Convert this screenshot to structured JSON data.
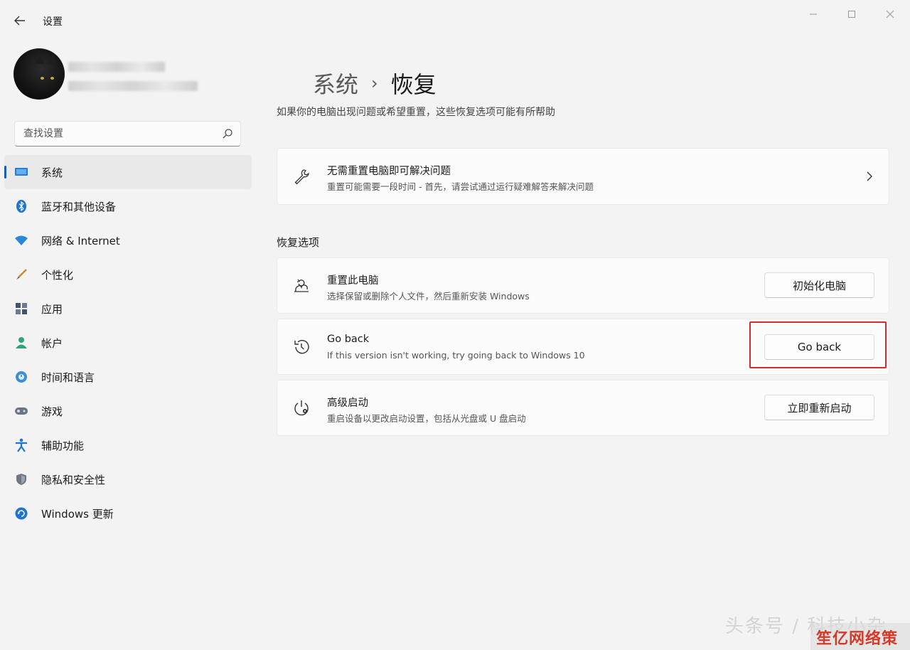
{
  "window": {
    "app_title": "设置",
    "back_icon": "back-arrow-icon",
    "controls": [
      "minimize-icon",
      "maximize-icon",
      "close-icon"
    ]
  },
  "search": {
    "placeholder": "查找设置",
    "icon": "search-icon"
  },
  "sidebar": {
    "items": [
      {
        "label": "系统",
        "icon": "monitor-icon",
        "active": true
      },
      {
        "label": "蓝牙和其他设备",
        "icon": "bluetooth-icon"
      },
      {
        "label": "网络 & Internet",
        "icon": "wifi-icon"
      },
      {
        "label": "个性化",
        "icon": "brush-icon"
      },
      {
        "label": "应用",
        "icon": "apps-icon"
      },
      {
        "label": "帐户",
        "icon": "account-icon"
      },
      {
        "label": "时间和语言",
        "icon": "globe-clock-icon"
      },
      {
        "label": "游戏",
        "icon": "gamepad-icon"
      },
      {
        "label": "辅助功能",
        "icon": "accessibility-icon"
      },
      {
        "label": "隐私和安全性",
        "icon": "shield-icon"
      },
      {
        "label": "Windows 更新",
        "icon": "update-icon"
      }
    ]
  },
  "main": {
    "breadcrumb_parent": "系统",
    "breadcrumb_sep": "›",
    "breadcrumb_current": "恢复",
    "subtitle": "如果你的电脑出现问题或希望重置，这些恢复选项可能有所帮助",
    "troubleshoot": {
      "title": "无需重置电脑即可解决问题",
      "desc": "重置可能需要一段时间 - 首先，请尝试通过运行疑难解答来解决问题",
      "icon": "wrench-icon"
    },
    "section_label": "恢复选项",
    "options": [
      {
        "title": "重置此电脑",
        "desc": "选择保留或删除个人文件，然后重新安装 Windows",
        "button": "初始化电脑",
        "icon": "reset-pc-icon"
      },
      {
        "title": "Go back",
        "desc": "If this version isn't working, try going back to Windows 10",
        "button": "Go back",
        "icon": "history-icon"
      },
      {
        "title": "高级启动",
        "desc": "重启设备以更改启动设置，包括从光盘或 U 盘启动",
        "button": "立即重新启动",
        "icon": "advanced-startup-icon"
      }
    ]
  },
  "watermark": {
    "text": "头条号 / 科技小杂",
    "badge": "笙亿网络策划"
  }
}
